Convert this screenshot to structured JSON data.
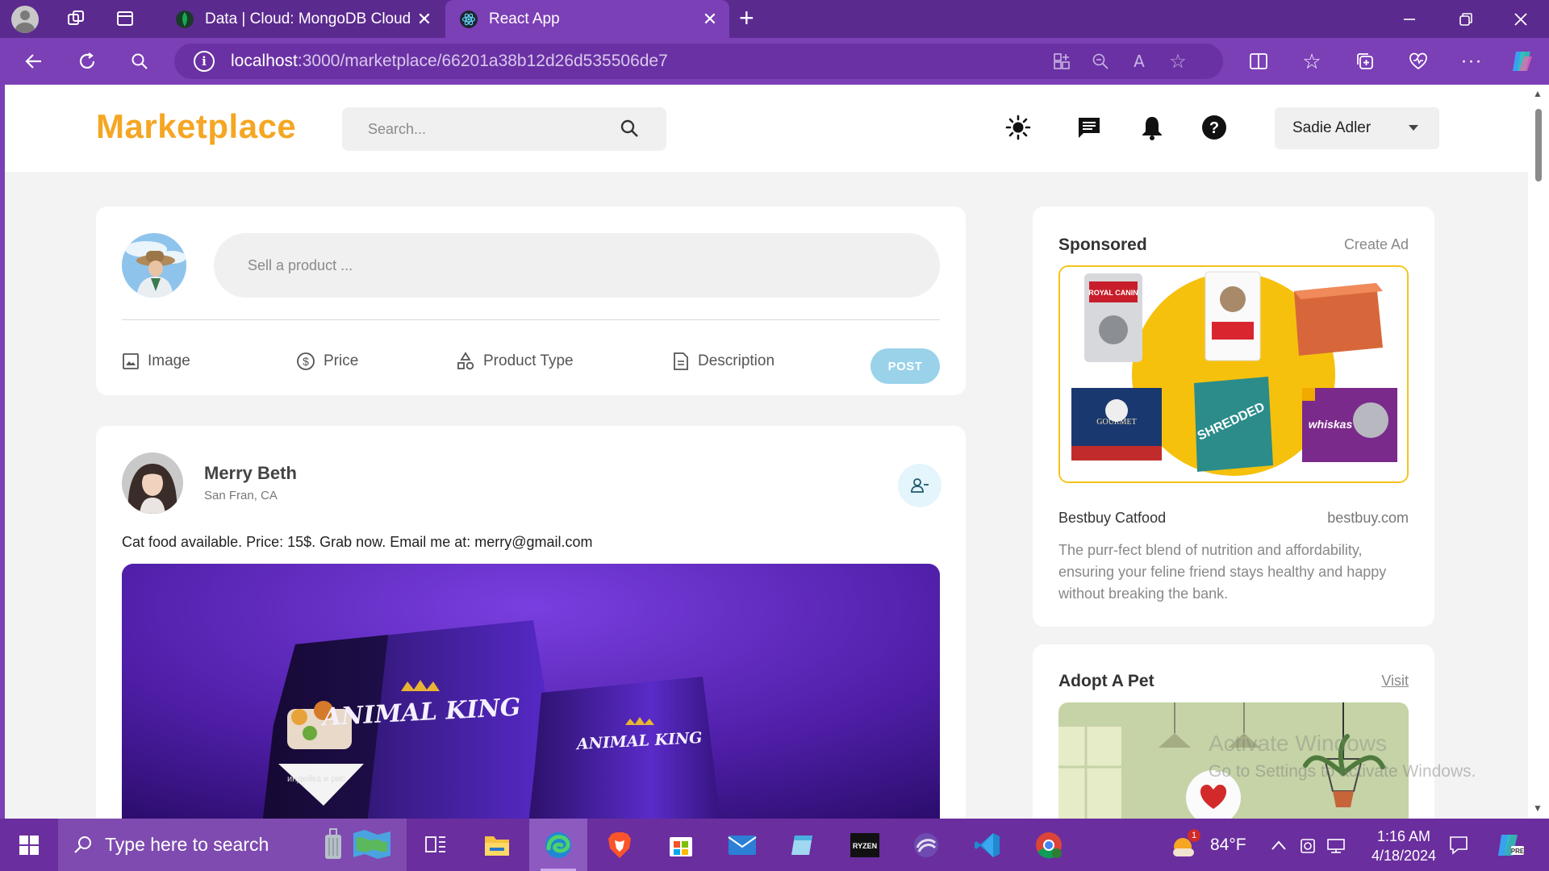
{
  "browser": {
    "tabs": [
      {
        "title": "Data | Cloud: MongoDB Cloud",
        "favicon": "mongodb-leaf-icon",
        "active": false
      },
      {
        "title": "React App",
        "favicon": "react-icon",
        "active": true
      }
    ],
    "url_host": "localhost",
    "url_rest": ":3000/marketplace/66201a38b12d26d535506de7",
    "colors": {
      "chrome": "#7b3fb6",
      "tabstrip": "#5b2a8f"
    }
  },
  "navbar": {
    "logo": "Marketplace",
    "search_placeholder": "Search...",
    "user_name": "Sadie Adler",
    "icons": [
      "sun-icon",
      "message-icon",
      "bell-icon",
      "help-icon"
    ]
  },
  "composer": {
    "placeholder": "Sell a product ...",
    "tools": [
      {
        "label": "Image",
        "icon": "image-icon"
      },
      {
        "label": "Price",
        "icon": "dollar-circle-icon"
      },
      {
        "label": "Product Type",
        "icon": "shapes-icon"
      },
      {
        "label": "Description",
        "icon": "document-icon"
      }
    ],
    "post_label": "POST"
  },
  "post": {
    "author": "Merry Beth",
    "location": "San Fran, CA",
    "text": "Cat food available. Price: 15$. Grab now. Email me at: merry@gmail.com",
    "image_text_1": "ANIMAL KING",
    "image_text_2": "ANIMAL KING",
    "image_text_3": "индейка и рис"
  },
  "sponsored": {
    "title": "Sponsored",
    "action": "Create Ad",
    "ad_name": "Bestbuy Catfood",
    "ad_domain": "bestbuy.com",
    "ad_description": "The purr-fect blend of nutrition and affordability, ensuring your feline friend stays healthy and happy without breaking the bank.",
    "product_labels": [
      "ROYAL CANIN",
      "SHREDDED",
      "whiskas",
      "GOURMET"
    ]
  },
  "adopt": {
    "title": "Adopt A Pet",
    "action": "Visit"
  },
  "watermark": {
    "line1": "Activate Windows",
    "line2": "Go to Settings to activate Windows."
  },
  "taskbar": {
    "search_placeholder": "Type here to search",
    "weather_temp": "84°F",
    "weather_badge": "1",
    "time": "1:16 AM",
    "date": "4/18/2024"
  }
}
